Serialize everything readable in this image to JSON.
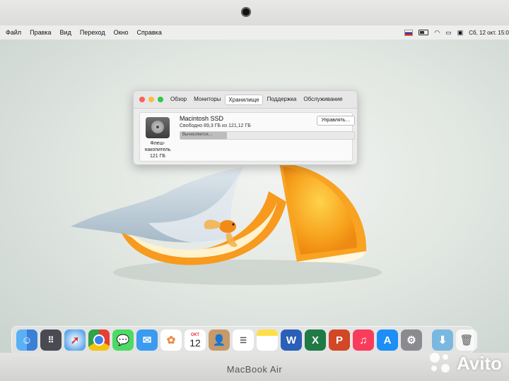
{
  "menubar": {
    "items": [
      "Файл",
      "Правка",
      "Вид",
      "Переход",
      "Окно",
      "Справка"
    ],
    "datetime": "Сб, 12 окт. 15:0"
  },
  "window": {
    "tabs": [
      "Обзор",
      "Мониторы",
      "Хранилище",
      "Поддержка",
      "Обслуживание"
    ],
    "active_tab": "Хранилище",
    "disk_name": "Macintosh SSD",
    "free_text": "Свободно 89,3 ГБ из 121,12 ГБ",
    "manage_button": "Управлять…",
    "progress_text": "Вычисляется…",
    "progress_fraction": 0.27,
    "disk_label_line1": "Флеш-",
    "disk_label_line2": "накопитель",
    "disk_label_line3": "121 ГБ"
  },
  "dock": {
    "calendar_month": "ОКТ",
    "calendar_day": "12",
    "apps": [
      "finder-icon",
      "launchpad-icon",
      "safari-icon",
      "chrome-icon",
      "messages-icon",
      "mail-icon",
      "photos-icon",
      "calendar-icon",
      "contacts-icon",
      "reminders-icon",
      "notes-icon",
      "word-icon",
      "excel-icon",
      "powerpoint-icon",
      "music-icon",
      "app-store-icon",
      "system-preferences-icon",
      "downloads-folder-icon",
      "trash-icon"
    ]
  },
  "device": {
    "brand": "MacBook Air",
    "watermark": "Avito"
  },
  "colors": {
    "close": "#fc605c",
    "minimize": "#fdbc40",
    "maximize": "#34c84a",
    "orange": "#f79a1e"
  }
}
